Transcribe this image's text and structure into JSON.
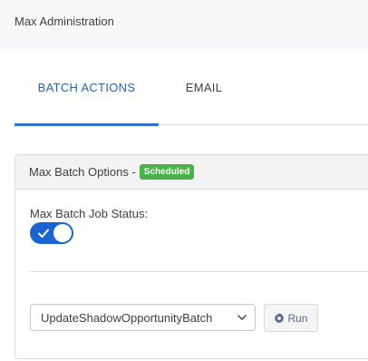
{
  "header": {
    "title": "Max Administration"
  },
  "tabs": [
    {
      "label": "BATCH ACTIONS",
      "active": true
    },
    {
      "label": "EMAIL",
      "active": false
    }
  ],
  "card": {
    "title": "Max Batch Options -",
    "badge": "Scheduled",
    "status_label": "Max Batch Job Status:",
    "toggle_on": true,
    "select_value": "UpdateShadowOpportunityBatch",
    "run_label": "Run"
  },
  "colors": {
    "accent": "#1b63d1",
    "tab_active": "#2d5fa6",
    "badge_green": "#4bb24b"
  },
  "icons": {
    "toggle": "check-icon",
    "select": "chevron-down-icon",
    "run": "gear-icon"
  }
}
